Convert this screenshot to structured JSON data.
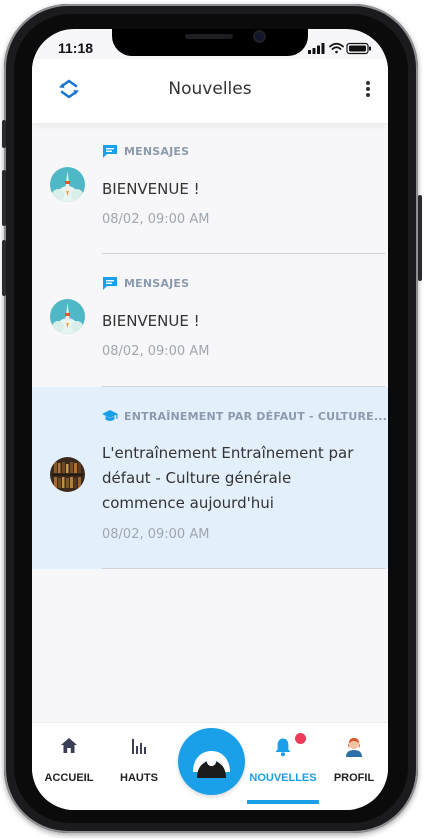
{
  "status_bar": {
    "time": "11:18"
  },
  "app_bar": {
    "title": "Nouvelles",
    "left_icon": "sync-arrows-icon",
    "right_icon": "more-vertical-icon"
  },
  "notifications": [
    {
      "category": "MENSAJES",
      "category_icon": "chat-bubble-icon",
      "message": "BIENVENUE !",
      "time": "08/02, 09:00 AM",
      "avatar": "rocket-avatar",
      "highlighted": false
    },
    {
      "category": "MENSAJES",
      "category_icon": "chat-bubble-icon",
      "message": "BIENVENUE !",
      "time": "08/02, 09:00 AM",
      "avatar": "rocket-avatar",
      "highlighted": false
    },
    {
      "category": "ENTRAÎNEMENT PAR DÉFAUT - CULTURE...",
      "category_icon": "graduation-cap-icon",
      "message": "L'entraînement Entraînement par défaut - Culture générale commence aujourd'hui",
      "time": "08/02, 09:00 AM",
      "avatar": "library-avatar",
      "highlighted": true
    }
  ],
  "bottom_nav": {
    "items": [
      {
        "label": "ACCUEIL",
        "icon": "home-icon",
        "active": false
      },
      {
        "label": "HAUTS",
        "icon": "bar-chart-icon",
        "active": false
      },
      {
        "label": "NOUVELLES",
        "icon": "bell-icon",
        "active": true,
        "badge": true
      },
      {
        "label": "PROFIL",
        "icon": "user-avatar-icon",
        "active": false
      }
    ],
    "center_button_icon": "eye-logo-icon"
  },
  "colors": {
    "accent": "#1aa0e8",
    "highlight_row": "#e3f0fb",
    "badge": "#ef3b5a",
    "category_text": "#8c9aae"
  }
}
